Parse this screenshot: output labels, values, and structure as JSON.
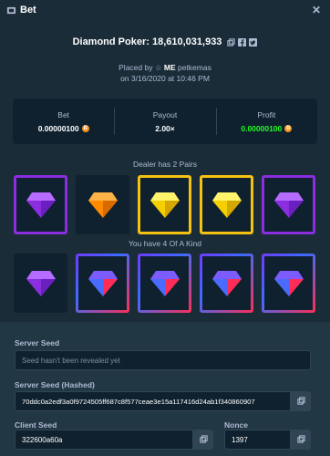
{
  "header": {
    "title": "Bet",
    "ticket_icon": "ticket-icon",
    "close_icon": "close-icon"
  },
  "game": {
    "title": "Diamond Poker: 18,610,031,933"
  },
  "placed": {
    "prefix": "Placed by",
    "user_tag": "ME",
    "username": "petkemas",
    "date": "on 3/16/2020 at 10:46 PM"
  },
  "stats": {
    "bet_label": "Bet",
    "bet_value": "0.00000100",
    "payout_label": "Payout",
    "payout_value": "2.00×",
    "profit_label": "Profit",
    "profit_value": "0.00000100",
    "coin": "B",
    "profit_color": "#1fff20"
  },
  "dealer": {
    "label": "Dealer has 2 Pairs",
    "cards": [
      {
        "gem": "purple",
        "highlight": "purple"
      },
      {
        "gem": "orange",
        "highlight": "none"
      },
      {
        "gem": "yellow",
        "highlight": "gold"
      },
      {
        "gem": "yellow",
        "highlight": "gold"
      },
      {
        "gem": "purple",
        "highlight": "purple"
      }
    ]
  },
  "player": {
    "label": "You have 4 Of A Kind",
    "cards": [
      {
        "gem": "purple",
        "highlight": "none"
      },
      {
        "gem": "rainbow",
        "highlight": "rainbow"
      },
      {
        "gem": "rainbow",
        "highlight": "rainbow"
      },
      {
        "gem": "rainbow",
        "highlight": "rainbow"
      },
      {
        "gem": "rainbow",
        "highlight": "rainbow"
      }
    ]
  },
  "seeds": {
    "server_seed_label": "Server Seed",
    "server_seed_value": "Seed hasn't been revealed yet",
    "server_seed_hashed_label": "Server Seed (Hashed)",
    "server_seed_hashed_value": "70ddc0a2edf3a0f9724505ff687c8f577ceae3e15a117416d24ab1f340860907",
    "client_seed_label": "Client Seed",
    "client_seed_value": "322600a60a",
    "nonce_label": "Nonce",
    "nonce_value": "1397"
  }
}
